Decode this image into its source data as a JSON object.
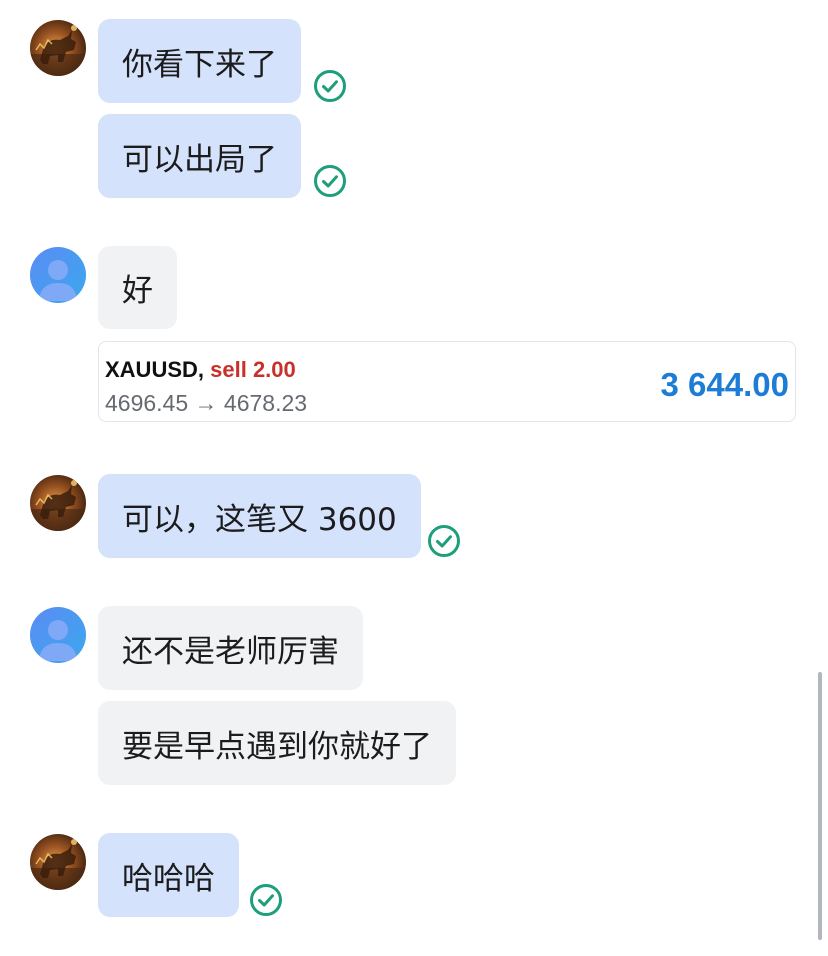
{
  "messages": [
    {
      "sender": "self",
      "text": "你看下来了",
      "status_icon": "sent-check-icon"
    },
    {
      "sender": "self",
      "text": "可以出局了",
      "status_icon": "sent-check-icon"
    },
    {
      "sender": "other",
      "text": "好"
    },
    {
      "sender": "self",
      "text": "可以，这笔又 3600",
      "status_icon": "sent-check-icon"
    },
    {
      "sender": "other",
      "text": "还不是老师厉害"
    },
    {
      "sender": "other",
      "text": "要是早点遇到你就好了"
    },
    {
      "sender": "self",
      "text": "哈哈哈",
      "status_icon": "sent-check-icon"
    }
  ],
  "trade_card": {
    "symbol": "XAUUSD,",
    "side": "sell 2.00",
    "prices": "4696.45 → 4678.23",
    "profit": "3 644.00"
  },
  "avatars": {
    "self": "bull-avatar-icon",
    "other": "default-user-avatar-icon"
  },
  "colors": {
    "outgoing_bubble": "#d4e3fb",
    "incoming_bubble": "#f1f2f4",
    "check_icon": "#1e9e7a",
    "sell_text": "#c8302a",
    "profit_text": "#1c7cd6",
    "user_avatar_gradient": [
      "#5a8bf4",
      "#3ca8ee"
    ]
  }
}
